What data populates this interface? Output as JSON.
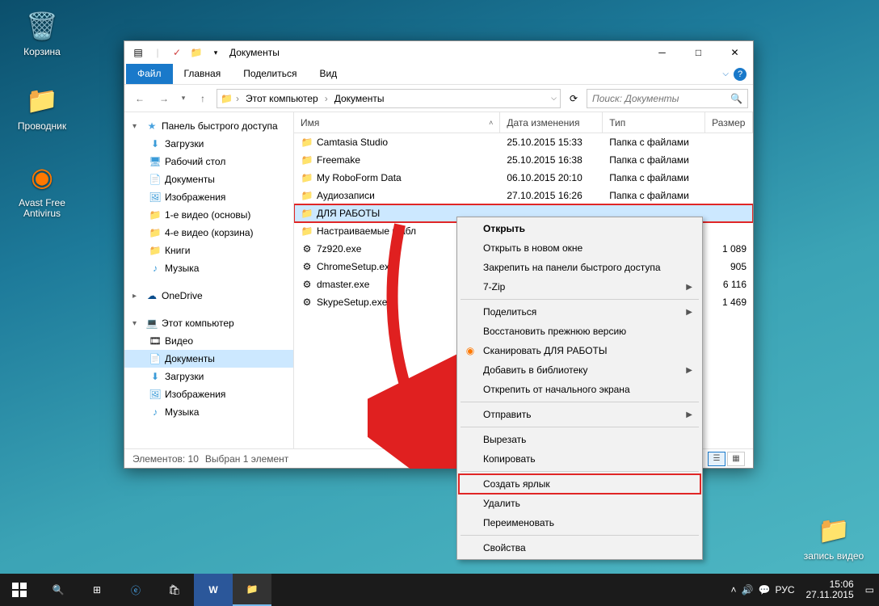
{
  "desktop": {
    "recycle": "Корзина",
    "explorer": "Проводник",
    "avast": "Avast Free Antivirus",
    "folder": "запись видео"
  },
  "window": {
    "title": "Документы",
    "tabs": {
      "file": "Файл",
      "home": "Главная",
      "share": "Поделиться",
      "view": "Вид"
    },
    "breadcrumb": {
      "pc": "Этот компьютер",
      "docs": "Документы"
    },
    "search_placeholder": "Поиск: Документы",
    "columns": {
      "name": "Имя",
      "date": "Дата изменения",
      "type": "Тип",
      "size": "Размер"
    },
    "quick_access": "Панель быстрого доступа",
    "tree": {
      "downloads": "Загрузки",
      "desktop": "Рабочий стол",
      "documents": "Документы",
      "pictures": "Изображения",
      "v1": "1-е видео (основы)",
      "v4": "4-е видео (корзина)",
      "books": "Книги",
      "music": "Музыка",
      "onedrive": "OneDrive",
      "this_pc": "Этот компьютер",
      "videos": "Видео",
      "documents2": "Документы",
      "downloads2": "Загрузки",
      "pictures2": "Изображения",
      "music2": "Музыка"
    },
    "rows": [
      {
        "name": "Camtasia Studio",
        "date": "25.10.2015 15:33",
        "type": "Папка с файлами",
        "size": "",
        "icon": "folder"
      },
      {
        "name": "Freemake",
        "date": "25.10.2015 16:38",
        "type": "Папка с файлами",
        "size": "",
        "icon": "folder"
      },
      {
        "name": "My RoboForm Data",
        "date": "06.10.2015 20:10",
        "type": "Папка с файлами",
        "size": "",
        "icon": "folder"
      },
      {
        "name": "Аудиозаписи",
        "date": "27.10.2015 16:26",
        "type": "Папка с файлами",
        "size": "",
        "icon": "folder"
      },
      {
        "name": "ДЛЯ РАБОТЫ",
        "date": "",
        "type": "",
        "size": "",
        "icon": "folder",
        "selected": true
      },
      {
        "name": "Настраиваемые шабл",
        "date": "",
        "type": "",
        "size": "",
        "icon": "folder"
      },
      {
        "name": "7z920.exe",
        "date": "",
        "type": "",
        "size": "1 089",
        "icon": "exe"
      },
      {
        "name": "ChromeSetup.exe",
        "date": "",
        "type": "",
        "size": "905",
        "icon": "exe"
      },
      {
        "name": "dmaster.exe",
        "date": "",
        "type": "",
        "size": "6 116",
        "icon": "exe"
      },
      {
        "name": "SkypeSetup.exe",
        "date": "",
        "type": "",
        "size": "1 469",
        "icon": "exe"
      }
    ],
    "status": {
      "count": "Элементов: 10",
      "sel": "Выбран 1 элемент"
    }
  },
  "ctx": {
    "open": "Открыть",
    "open_new": "Открыть в новом окне",
    "pin_qa": "Закрепить на панели быстрого доступа",
    "zip": "7-Zip",
    "share": "Поделиться",
    "restore": "Восстановить прежнюю версию",
    "scan": "Сканировать ДЛЯ РАБОТЫ",
    "library": "Добавить в библиотеку",
    "unpin": "Открепить от начального экрана",
    "send": "Отправить",
    "cut": "Вырезать",
    "copy": "Копировать",
    "link": "Создать ярлык",
    "delete": "Удалить",
    "rename": "Переименовать",
    "props": "Свойства"
  },
  "taskbar": {
    "lang": "РУС",
    "time": "15:06",
    "date": "27.11.2015"
  }
}
